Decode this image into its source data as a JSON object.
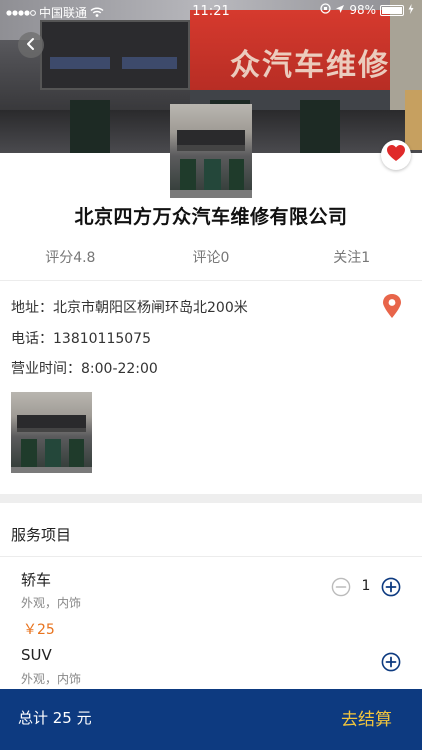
{
  "status_bar": {
    "carrier": "中国联通",
    "time": "11:21",
    "battery": "98%"
  },
  "shop": {
    "name": "北京四方万众汽车维修有限公司",
    "stats": {
      "rating": "评分4.8",
      "reviews": "评论0",
      "follows": "关注1"
    },
    "address": "地址：北京市朝阳区杨闸环岛北200米",
    "phone": "电话：13810115075",
    "hours": "营业时间：8:00-22:00"
  },
  "services": {
    "title": "服务项目",
    "items": [
      {
        "name": "轿车",
        "desc": "外观，内饰",
        "price": "￥25",
        "qty": "1"
      },
      {
        "name": "SUV",
        "desc": "外观，内饰"
      }
    ]
  },
  "footer": {
    "total": "总计 25 元",
    "checkout": "去结算"
  },
  "colors": {
    "brand_navy": "#0d3a80",
    "checkout_yellow": "#f2c53d",
    "price_orange": "#e8731e",
    "heart_red": "#e02a2a",
    "pin_orange": "#e8654a"
  }
}
